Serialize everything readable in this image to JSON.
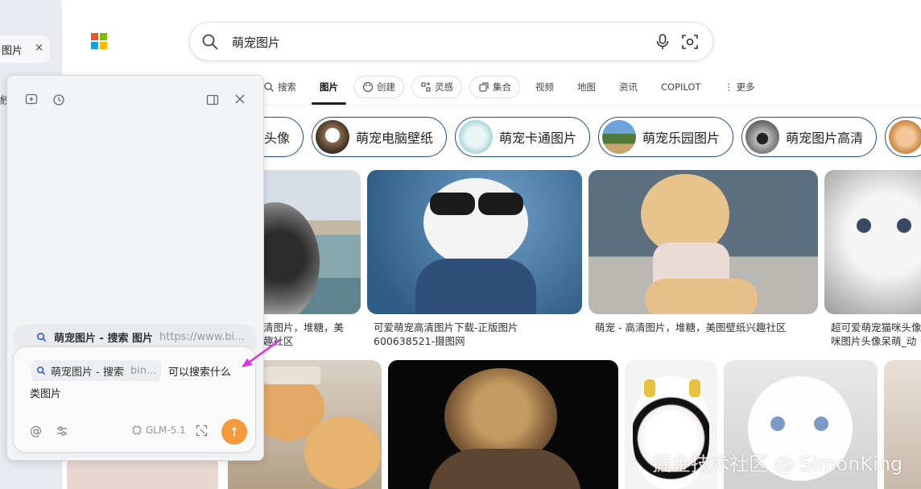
{
  "left_tab": {
    "label": "图片",
    "close": "×",
    "cut_label": "絞"
  },
  "search": {
    "query": "萌宠图片"
  },
  "nav": [
    {
      "label": "搜索",
      "kind": "plain"
    },
    {
      "label": "图片",
      "kind": "active"
    },
    {
      "label": "创建",
      "kind": "pill"
    },
    {
      "label": "灵感",
      "kind": "pill"
    },
    {
      "label": "集合",
      "kind": "pill"
    },
    {
      "label": "视频",
      "kind": "plain"
    },
    {
      "label": "地图",
      "kind": "plain"
    },
    {
      "label": "资讯",
      "kind": "plain"
    },
    {
      "label": "COPILOT",
      "kind": "plain"
    },
    {
      "label": "⋮ 更多",
      "kind": "plain"
    }
  ],
  "chips": [
    {
      "label": "头像"
    },
    {
      "label": "萌宠电脑壁纸"
    },
    {
      "label": "萌宠卡通图片"
    },
    {
      "label": "萌宠乐园图片"
    },
    {
      "label": "萌宠图片高清"
    }
  ],
  "results": [
    {
      "caption1": "清图片，堆糖，美",
      "caption2": "趣社区"
    },
    {
      "caption1": "可爱萌宠高清图片下载-正版图片",
      "caption2": "600638521-摄图网"
    },
    {
      "caption1": "萌宠 - 高清图片，堆糖，美图壁纸兴趣社区",
      "caption2": ""
    },
    {
      "caption1": "超可爱萌宠猫咪头像",
      "caption2": "咪图片头像呆萌_动"
    }
  ],
  "panel": {
    "suggestion": {
      "title": "萌宠图片 - 搜索 图片",
      "url": "https://www.bi..."
    },
    "ref_chip": {
      "title": "萌宠图片 - 搜索",
      "url": "bin..."
    },
    "question_line1": "可以搜索什么",
    "question_line2": "类图片",
    "model": "GLM-5.1",
    "send": "↑"
  },
  "watermark": "掘金技术社区 @ SimonKing"
}
